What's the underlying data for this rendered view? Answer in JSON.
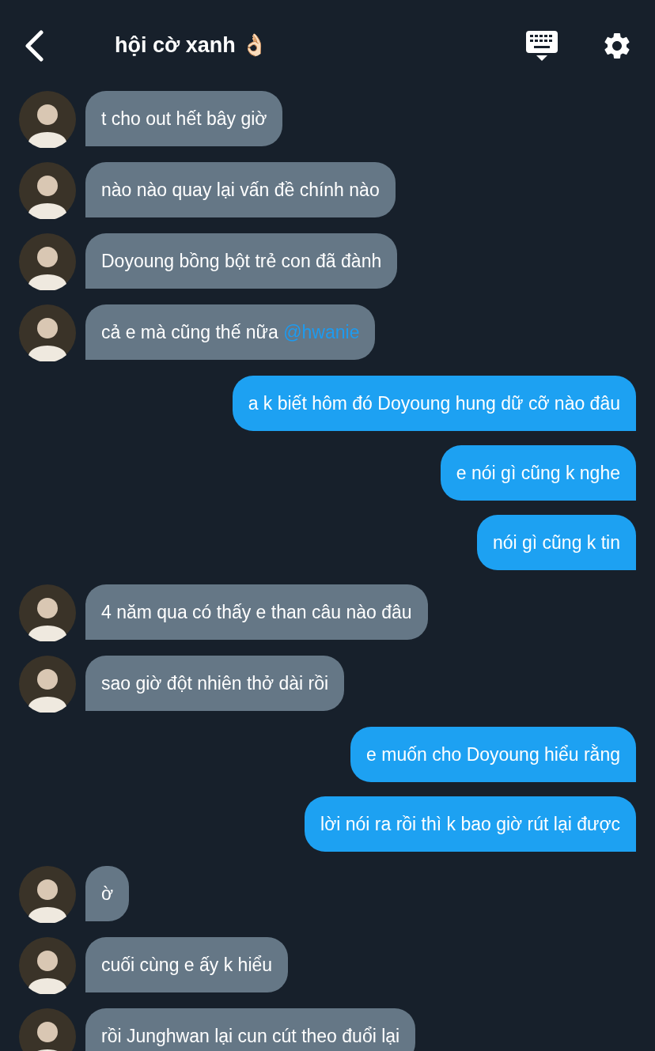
{
  "header": {
    "title": "hội cờ xanh 👌🏻"
  },
  "messages": [
    {
      "kind": "incoming",
      "text": "t cho out hết bây giờ"
    },
    {
      "kind": "incoming",
      "text": "nào nào quay lại vấn đề chính nào"
    },
    {
      "kind": "incoming",
      "text": "Doyoung bồng bột trẻ con đã đành"
    },
    {
      "kind": "incoming",
      "text": "cả e mà cũng thế nữa",
      "mention": "@hwanie"
    },
    {
      "kind": "outgoing",
      "text": "a k biết hôm đó Doyoung hung dữ cỡ nào đâu"
    },
    {
      "kind": "outgoing",
      "text": "e nói gì cũng k nghe"
    },
    {
      "kind": "outgoing",
      "text": "nói gì cũng k tin"
    },
    {
      "kind": "incoming",
      "text": "4 năm qua có thấy e than câu nào đâu"
    },
    {
      "kind": "incoming",
      "text": "sao giờ đột nhiên thở dài rồi"
    },
    {
      "kind": "outgoing",
      "text": "e muốn cho Doyoung hiểu rằng"
    },
    {
      "kind": "outgoing",
      "text": "lời nói ra rồi thì k bao giờ rút lại được"
    },
    {
      "kind": "incoming",
      "text": "ờ"
    },
    {
      "kind": "incoming",
      "text": "cuối cùng e ấy k hiểu"
    },
    {
      "kind": "incoming",
      "text": "rồi Junghwan lại cun cút theo đuổi lại"
    }
  ]
}
